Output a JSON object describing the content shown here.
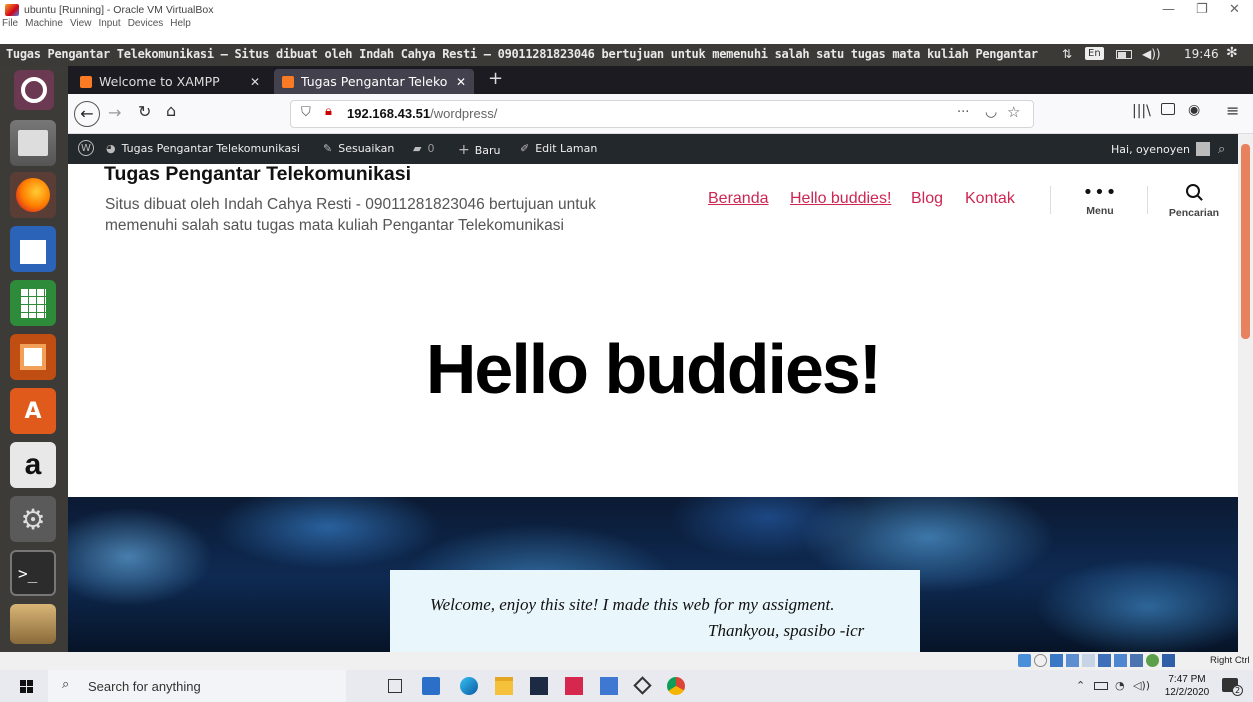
{
  "vbox": {
    "title": "ubuntu [Running] - Oracle VM VirtualBox",
    "menu": [
      "File",
      "Machine",
      "View",
      "Input",
      "Devices",
      "Help"
    ],
    "status_host_key": "Right Ctrl"
  },
  "ubuntu_panel": {
    "window_title": "Tugas Pengantar Telekomunikasi – Situs dibuat oleh Indah Cahya Resti – 09011281823046 bertujuan untuk memenuhi salah satu tugas mata kuliah Pengantar",
    "keyboard": "En",
    "time": "19:46"
  },
  "browser": {
    "tabs": [
      {
        "label": "Welcome to XAMPP",
        "active": false
      },
      {
        "label": "Tugas Pengantar Teleko",
        "active": true
      }
    ],
    "url_host": "192.168.43.51",
    "url_path": "/wordpress/",
    "url_more": "···"
  },
  "wp_admin_bar": {
    "site_name": "Tugas Pengantar Telekomunikasi",
    "customize": "Sesuaikan",
    "comments_count": "0",
    "new": "Baru",
    "edit": "Edit Laman",
    "greeting": "Hai, oyenoyen"
  },
  "site": {
    "title": "Tugas Pengantar Telekomunikasi",
    "description": "Situs dibuat oleh Indah Cahya Resti - 09011281823046 bertujuan untuk memenuhi salah satu tugas mata kuliah Pengantar Telekomunikasi",
    "nav": [
      "Beranda",
      "Hello buddies!",
      "Blog",
      "Kontak"
    ],
    "menu_label": "Menu",
    "search_label": "Pencarian",
    "accent_color": "#cd2653"
  },
  "content": {
    "heading": "Hello buddies!",
    "cover_line1": "Welcome, enjoy this site! I made this web for my assigment.",
    "cover_line2": "Thankyou, spasibo -icr"
  },
  "taskbar": {
    "search_placeholder": "Search for anything",
    "time": "7:47 PM",
    "date": "12/2/2020",
    "notification_count": "2"
  }
}
